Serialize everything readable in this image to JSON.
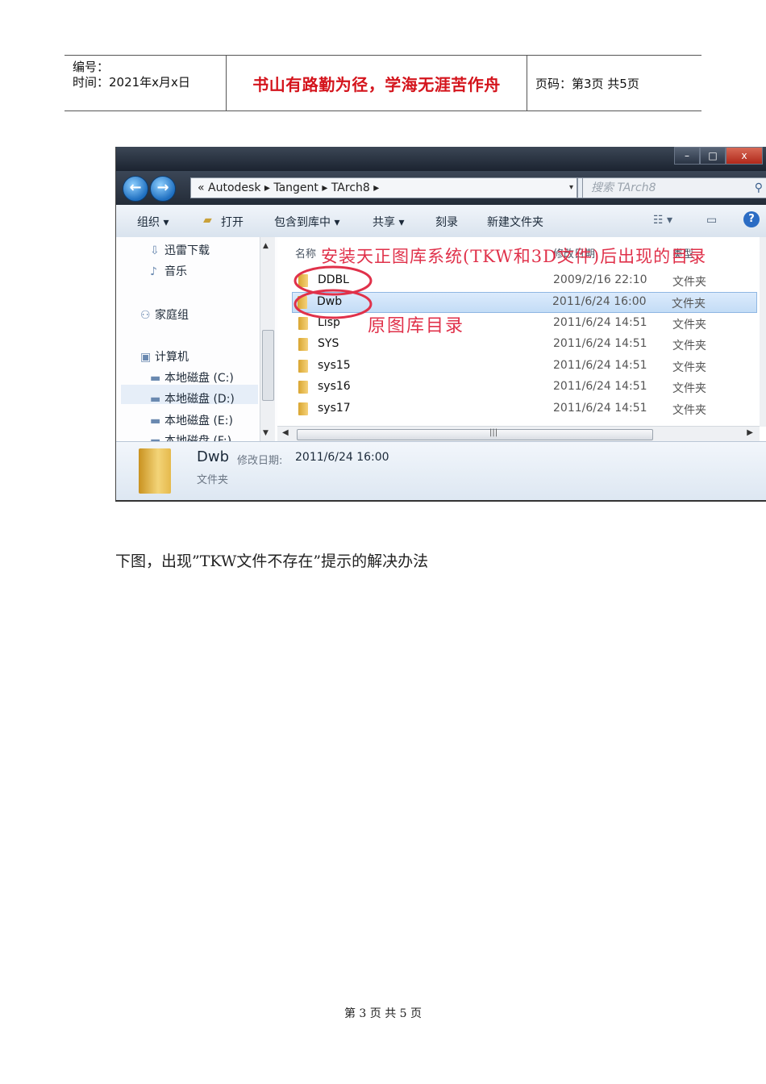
{
  "header": {
    "number_label": "编号：",
    "time_label": "时间：2021年x月x日",
    "motto": "书山有路勤为径，学海无涯苦作舟",
    "page_info": "页码：第3页 共5页"
  },
  "explorer": {
    "window_buttons": [
      "–",
      "□",
      "x"
    ],
    "address": {
      "segments": [
        "«",
        "Autodesk",
        "▸",
        "Tangent",
        "▸",
        "TArch8",
        "▸"
      ],
      "text": "« Autodesk ▸ Tangent ▸ TArch8 ▸"
    },
    "search_placeholder": "搜索 TArch8",
    "toolbar": {
      "organize": "组织 ▾",
      "open": "打开",
      "include": "包含到库中 ▾",
      "share": "共享 ▾",
      "burn": "刻录",
      "new_folder": "新建文件夹"
    },
    "nav": {
      "thunder": "迅雷下载",
      "music": "音乐",
      "homegroup": "家庭组",
      "computer": "计算机",
      "disk_c": "本地磁盘 (C:)",
      "disk_d": "本地磁盘 (D:)",
      "disk_e": "本地磁盘 (E:)",
      "disk_f": "本地磁盘 (F:)"
    },
    "columns": {
      "name": "名称",
      "date": "修改日期",
      "type": "类型"
    },
    "rows": [
      {
        "name": "DDBL",
        "date": "2009/2/16 22:10",
        "type": "文件夹"
      },
      {
        "name": "Dwb",
        "date": "2011/6/24 16:00",
        "type": "文件夹"
      },
      {
        "name": "Lisp",
        "date": "2011/6/24 14:51",
        "type": "文件夹"
      },
      {
        "name": "SYS",
        "date": "2011/6/24 14:51",
        "type": "文件夹"
      },
      {
        "name": "sys15",
        "date": "2011/6/24 14:51",
        "type": "文件夹"
      },
      {
        "name": "sys16",
        "date": "2011/6/24 14:51",
        "type": "文件夹"
      },
      {
        "name": "sys17",
        "date": "2011/6/24 14:51",
        "type": "文件夹"
      }
    ],
    "details": {
      "name": "Dwb",
      "modified_label": "修改日期:",
      "modified_value": "2011/6/24 16:00",
      "type": "文件夹"
    },
    "annotations": {
      "top": "安装天正图库系统(TKW和3D文件)后出现的目录",
      "orig": "原图库目录",
      "color": "#e0314a"
    }
  },
  "caption": "下图，出现”TKW文件不存在”提示的解决办法",
  "footer": "第 3 页 共 5 页"
}
